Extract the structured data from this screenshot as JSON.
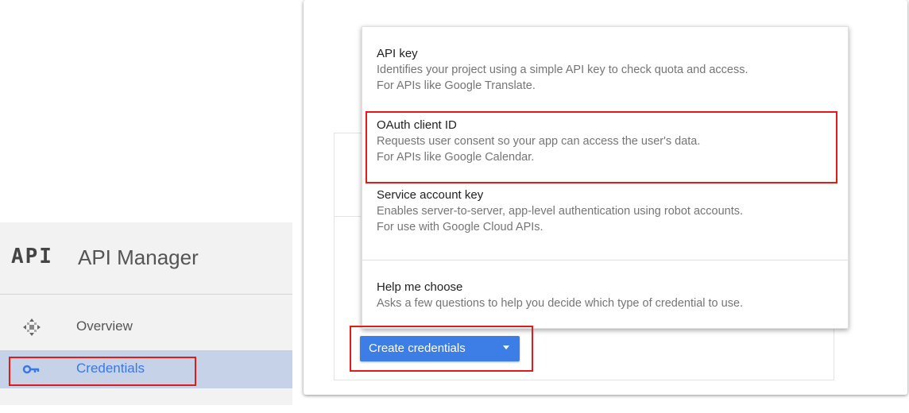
{
  "sidebar": {
    "logo": "API",
    "title": "API Manager",
    "items": [
      {
        "label": "Overview",
        "icon": "overview-icon"
      },
      {
        "label": "Credentials",
        "icon": "key-icon",
        "selected": true
      }
    ]
  },
  "menu": {
    "items": [
      {
        "title": "API key",
        "desc1": "Identifies your project using a simple API key to check quota and access.",
        "desc2": "For APIs like Google Translate."
      },
      {
        "title": "OAuth client ID",
        "desc1": "Requests user consent so your app can access the user's data.",
        "desc2": "For APIs like Google Calendar."
      },
      {
        "title": "Service account key",
        "desc1": "Enables server-to-server, app-level authentication using robot accounts.",
        "desc2": "For use with Google Cloud APIs."
      },
      {
        "title": "Help me choose",
        "desc1": "Asks a few questions to help you decide which type of credential to use."
      }
    ]
  },
  "create_button": {
    "label": "Create credentials",
    "icon": "caret-down-icon"
  },
  "colors": {
    "accent": "#3d7de6",
    "selected_bg": "#c5d2e7",
    "selected_text": "#3b78e7",
    "highlight": "#e21a1a"
  }
}
